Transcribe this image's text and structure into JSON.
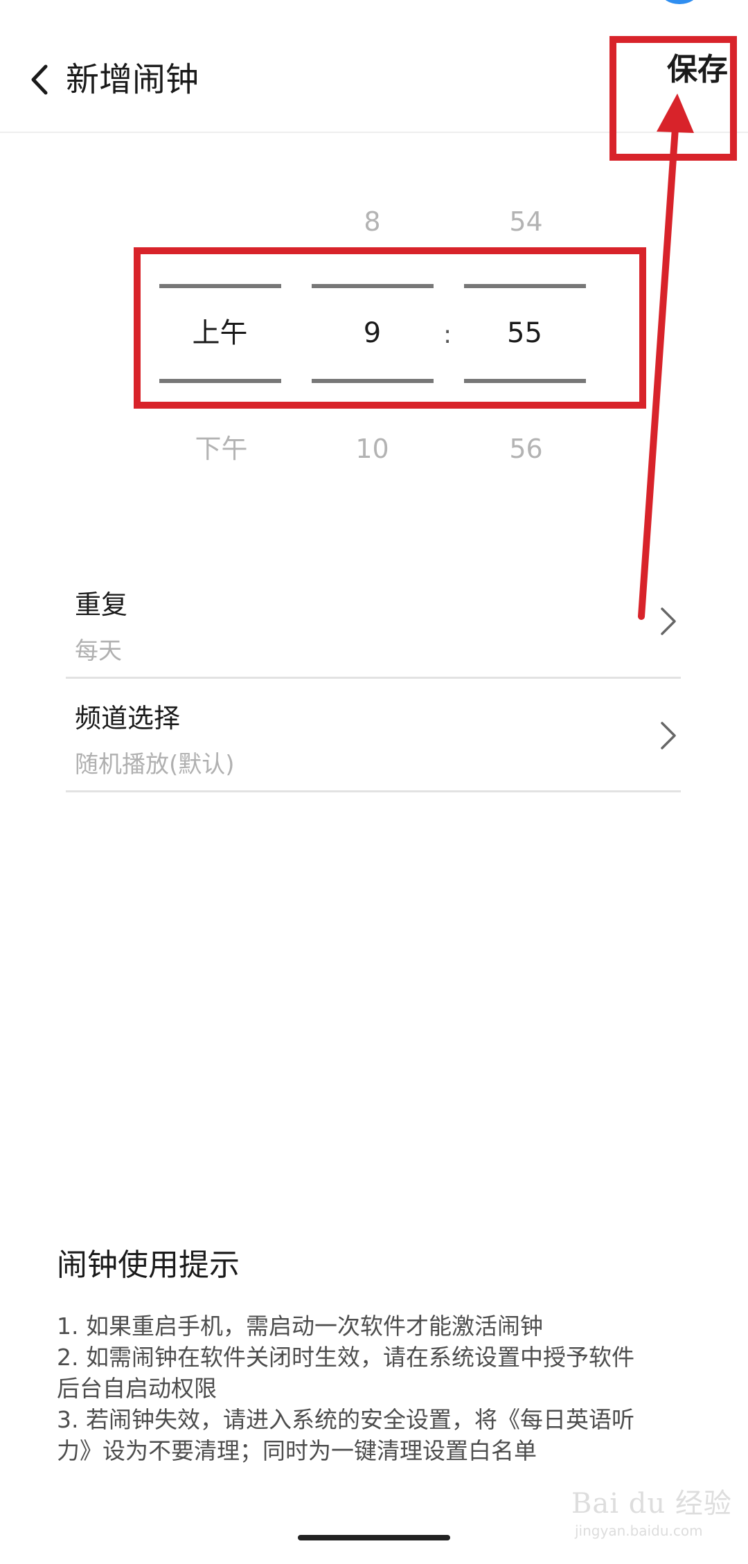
{
  "header": {
    "title": "新增闹钟",
    "save_label": "保存"
  },
  "time_picker": {
    "period": {
      "above": "",
      "selected": "上午",
      "below": "下午"
    },
    "hour": {
      "above": "8",
      "selected": "9",
      "below": "10"
    },
    "separator": ":",
    "minute": {
      "above": "54",
      "selected": "55",
      "below": "56"
    }
  },
  "settings": {
    "repeat": {
      "title": "重复",
      "value": "每天"
    },
    "channel": {
      "title": "频道选择",
      "value": "随机播放(默认)"
    }
  },
  "tips": {
    "title": "闹钟使用提示",
    "lines": [
      "1. 如果重启手机，需启动一次软件才能激活闹钟",
      "2. 如需闹钟在软件关闭时生效，请在系统设置中授予软件",
      "后台自启动权限",
      "3. 若闹钟失效，请进入系统的安全设置，将《每日英语听",
      "力》设为不要清理；同时为一键清理设置白名单"
    ]
  },
  "watermark": {
    "text": "Bai du 经验",
    "url": "jingyan.baidu.com"
  },
  "colors": {
    "annotation": "#d8232a",
    "dim_text": "#b3b3b3",
    "divider": "#e2e2e2"
  },
  "icons": {
    "back": "chevron-left-icon",
    "row_arrow": "chevron-right-icon"
  }
}
